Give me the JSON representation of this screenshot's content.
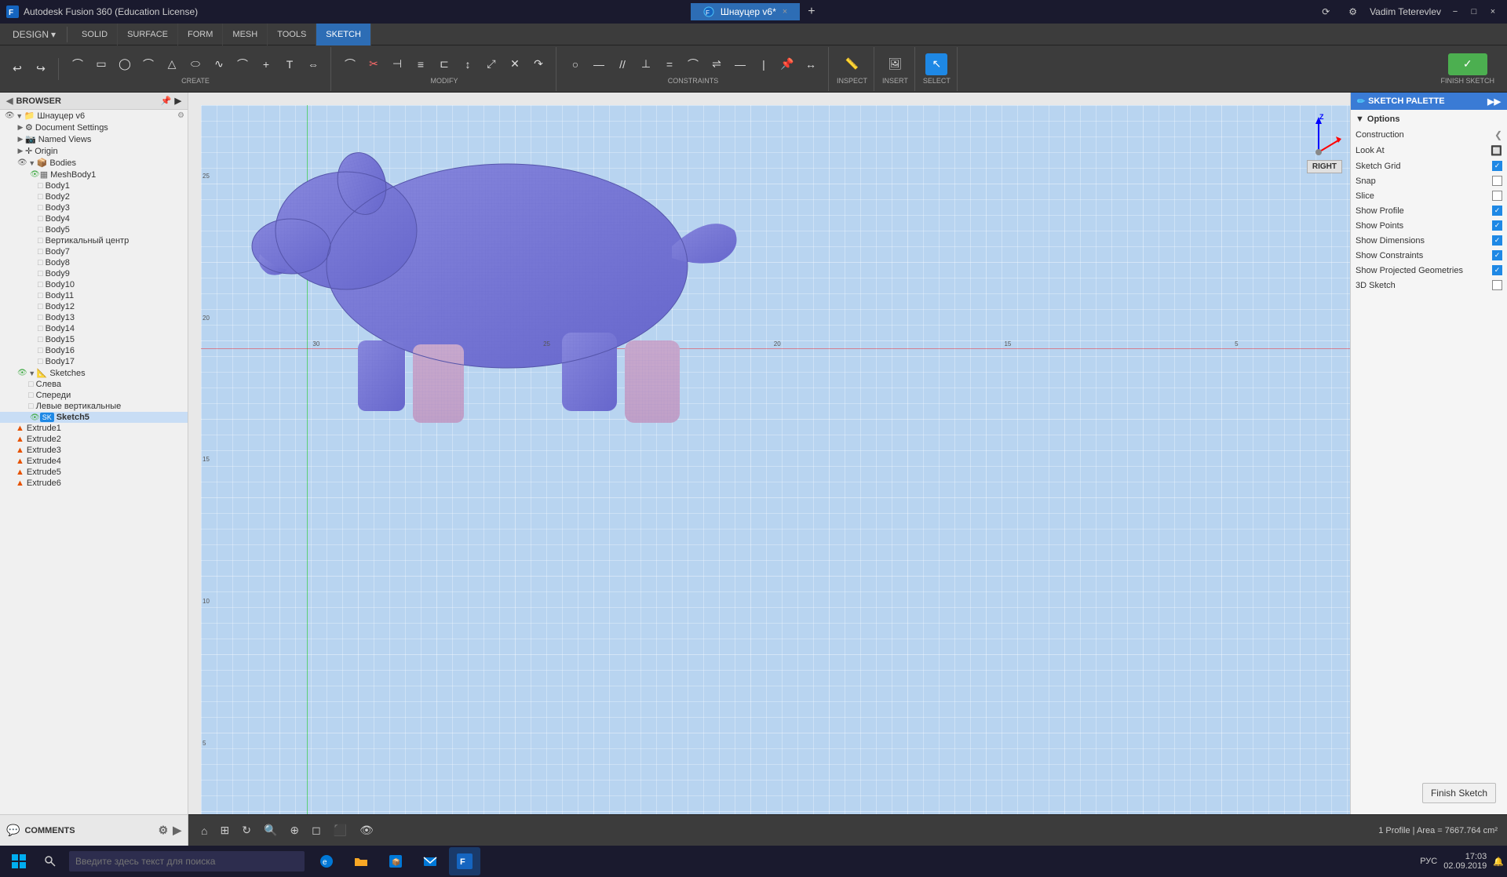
{
  "titlebar": {
    "app_name": "Autodesk Fusion 360 (Education License)",
    "tab_label": "Шнауцер v6*",
    "close_label": "×",
    "minimize_label": "−",
    "maximize_label": "□",
    "tab_close": "×"
  },
  "toolbar": {
    "design_label": "DESIGN",
    "design_arrow": "▾",
    "workspaces": [
      "SOLID",
      "SURFACE",
      "FORM",
      "MESH",
      "TOOLS",
      "SKETCH"
    ],
    "active_workspace": "SKETCH",
    "groups": {
      "create_label": "CREATE",
      "modify_label": "MODIFY",
      "constraints_label": "CONSTRAINTS",
      "inspect_label": "INSPECT",
      "insert_label": "INSERT",
      "select_label": "SELECT",
      "finish_sketch_label": "FINISH SKETCH"
    }
  },
  "browser": {
    "title": "BROWSER",
    "items": [
      {
        "label": "Шнауцер v6",
        "indent": 0,
        "type": "root",
        "expanded": true,
        "visible": true
      },
      {
        "label": "Document Settings",
        "indent": 1,
        "type": "settings",
        "expanded": false
      },
      {
        "label": "Named Views",
        "indent": 1,
        "type": "views",
        "expanded": false
      },
      {
        "label": "Origin",
        "indent": 1,
        "type": "origin",
        "expanded": false
      },
      {
        "label": "Bodies",
        "indent": 1,
        "type": "folder",
        "expanded": true
      },
      {
        "label": "MeshBody1",
        "indent": 2,
        "type": "mesh",
        "visible": true
      },
      {
        "label": "Body1",
        "indent": 3,
        "type": "body",
        "visible": false
      },
      {
        "label": "Body2",
        "indent": 3,
        "type": "body",
        "visible": false
      },
      {
        "label": "Body3",
        "indent": 3,
        "type": "body",
        "visible": false
      },
      {
        "label": "Body4",
        "indent": 3,
        "type": "body",
        "visible": false
      },
      {
        "label": "Body5",
        "indent": 3,
        "type": "body",
        "visible": false
      },
      {
        "label": "Вертикальный центр",
        "indent": 3,
        "type": "body",
        "visible": false
      },
      {
        "label": "Body7",
        "indent": 3,
        "type": "body",
        "visible": false
      },
      {
        "label": "Body8",
        "indent": 3,
        "type": "body",
        "visible": false
      },
      {
        "label": "Body9",
        "indent": 3,
        "type": "body",
        "visible": false
      },
      {
        "label": "Body10",
        "indent": 3,
        "type": "body",
        "visible": false
      },
      {
        "label": "Body11",
        "indent": 3,
        "type": "body",
        "visible": false
      },
      {
        "label": "Body12",
        "indent": 3,
        "type": "body",
        "visible": false
      },
      {
        "label": "Body13",
        "indent": 3,
        "type": "body",
        "visible": false
      },
      {
        "label": "Body14",
        "indent": 3,
        "type": "body",
        "visible": false
      },
      {
        "label": "Body15",
        "indent": 3,
        "type": "body",
        "visible": false
      },
      {
        "label": "Body16",
        "indent": 3,
        "type": "body",
        "visible": false
      },
      {
        "label": "Body17",
        "indent": 3,
        "type": "body",
        "visible": false
      },
      {
        "label": "Sketches",
        "indent": 1,
        "type": "folder",
        "expanded": true
      },
      {
        "label": "Слева",
        "indent": 2,
        "type": "sketch"
      },
      {
        "label": "Спереди",
        "indent": 2,
        "type": "sketch"
      },
      {
        "label": "Левые вертикальные",
        "indent": 2,
        "type": "sketch"
      },
      {
        "label": "Sketch5",
        "indent": 2,
        "type": "sketch",
        "active": true,
        "visible": true
      },
      {
        "label": "Extrude1",
        "indent": 1,
        "type": "extrude"
      },
      {
        "label": "Extrude2",
        "indent": 1,
        "type": "extrude"
      },
      {
        "label": "Extrude3",
        "indent": 1,
        "type": "extrude"
      },
      {
        "label": "Extrude4",
        "indent": 1,
        "type": "extrude"
      },
      {
        "label": "Extrude5",
        "indent": 1,
        "type": "extrude"
      },
      {
        "label": "Extrude6",
        "indent": 1,
        "type": "extrude"
      }
    ]
  },
  "sketch_palette": {
    "header": "SKETCH PALETTE",
    "section_label": "Options",
    "options": [
      {
        "label": "Construction",
        "has_arrow": true,
        "checked": false,
        "show_checkbox": false
      },
      {
        "label": "Look At",
        "has_icon": true,
        "checked": false,
        "show_checkbox": false
      },
      {
        "label": "Sketch Grid",
        "checked": true,
        "show_checkbox": true
      },
      {
        "label": "Snap",
        "checked": false,
        "show_checkbox": true
      },
      {
        "label": "Slice",
        "checked": false,
        "show_checkbox": true
      },
      {
        "label": "Show Profile",
        "checked": true,
        "show_checkbox": true
      },
      {
        "label": "Show Points",
        "checked": true,
        "show_checkbox": true
      },
      {
        "label": "Show Dimensions",
        "checked": true,
        "show_checkbox": true
      },
      {
        "label": "Show Constraints",
        "checked": true,
        "show_checkbox": true
      },
      {
        "label": "Show Projected Geometries",
        "checked": true,
        "show_checkbox": true
      },
      {
        "label": "3D Sketch",
        "checked": false,
        "show_checkbox": true
      }
    ],
    "finish_btn": "Finish Sketch"
  },
  "axis": {
    "z_label": "Z",
    "right_label": "RIGHT"
  },
  "status": {
    "text": "1 Profile | Area = 7667.764 cm²",
    "view_icons": [
      "grid",
      "display",
      "inspect"
    ]
  },
  "comments": {
    "label": "COMMENTS"
  },
  "taskbar": {
    "search_placeholder": "Введите здесь текст для поиска",
    "time": "17:03",
    "date": "02.09.2019",
    "lang": "РУС"
  }
}
